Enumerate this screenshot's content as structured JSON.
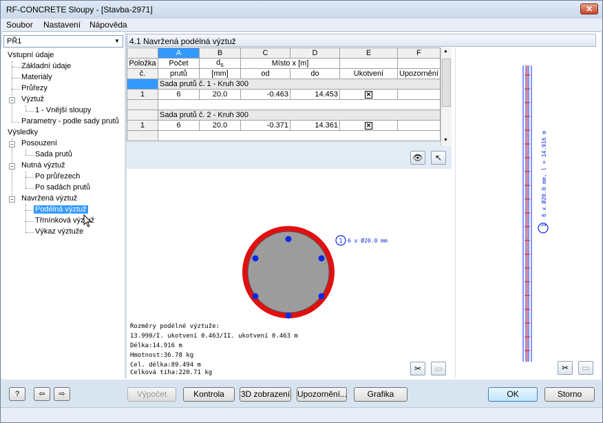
{
  "window": {
    "title": "RF-CONCRETE Sloupy - [Stavba-2971]",
    "close_label": "✕"
  },
  "menu": [
    "Soubor",
    "Nastavení",
    "Nápověda"
  ],
  "case_select": {
    "value": "PŘ1"
  },
  "tree": {
    "input": "Vstupní údaje",
    "basic": "Základní údaje",
    "materials": "Materiály",
    "sections": "Průřezy",
    "reinforcement": "Výztuž",
    "outer_columns": "1 - Vnější sloupy",
    "parameters": "Parametry - podle sady prutů",
    "results": "Výsledky",
    "checks": "Posouzení",
    "member_sets": "Sada prutů",
    "required": "Nutná výztuž",
    "by_sections": "Po průřezech",
    "by_sets": "Po sadách prutů",
    "designed": "Navržená výztuž",
    "longitudinal": "Podélná výztuž",
    "stirrup": "Třmínková výztuž",
    "bill": "Výkaz výztuže"
  },
  "panel_title": "4.1 Navržená podélná výztuž",
  "table": {
    "col_letters": [
      "A",
      "B",
      "C",
      "D",
      "E",
      "F"
    ],
    "hdr1": [
      "Položka",
      "Počet",
      "d",
      "Místo x [m]",
      "",
      ""
    ],
    "hdr1_sub": "s",
    "hdr2": [
      "č.",
      "prutů",
      "[mm]",
      "od",
      "do",
      "Ukotvení",
      "Upozornění"
    ],
    "groups": [
      {
        "title": "Sada prutů č. 1 - Kruh 300",
        "row": {
          "no": "1",
          "count": "6",
          "ds": "20.0",
          "from": "-0.463",
          "to": "14.453",
          "anchor": "☒"
        }
      },
      {
        "title": "Sada prutů č. 2 - Kruh 300",
        "row": {
          "no": "1",
          "count": "6",
          "ds": "20.0",
          "from": "-0.371",
          "to": "14.361",
          "anchor": "☒"
        }
      }
    ]
  },
  "graphic": {
    "label": "6 x Ø20.0 mm",
    "label_marker": "1",
    "info": [
      "Rozměry podélné výztuže:",
      "13.990/I. ukotvení 0.463/II. ukotvení 0.463 m",
      "Délka:14.916 m",
      "Hmotnost:36.78 kg",
      "Cel. délka:89.494 m",
      "Celková tíha:220.71 kg"
    ]
  },
  "side": {
    "label": "6 x Ø20.0 mm, l = 14.916 m",
    "marker": "1"
  },
  "buttons": {
    "calc": "Výpočet",
    "check": "Kontrola",
    "view3d": "3D zobrazení",
    "warnings": "Upozornění...",
    "graphics": "Grafika",
    "ok": "OK",
    "cancel": "Storno"
  },
  "colors": {
    "ring": "#e01010",
    "section": "#9c9c9c",
    "bar": "#0a28e6",
    "accent": "#3399ff"
  }
}
